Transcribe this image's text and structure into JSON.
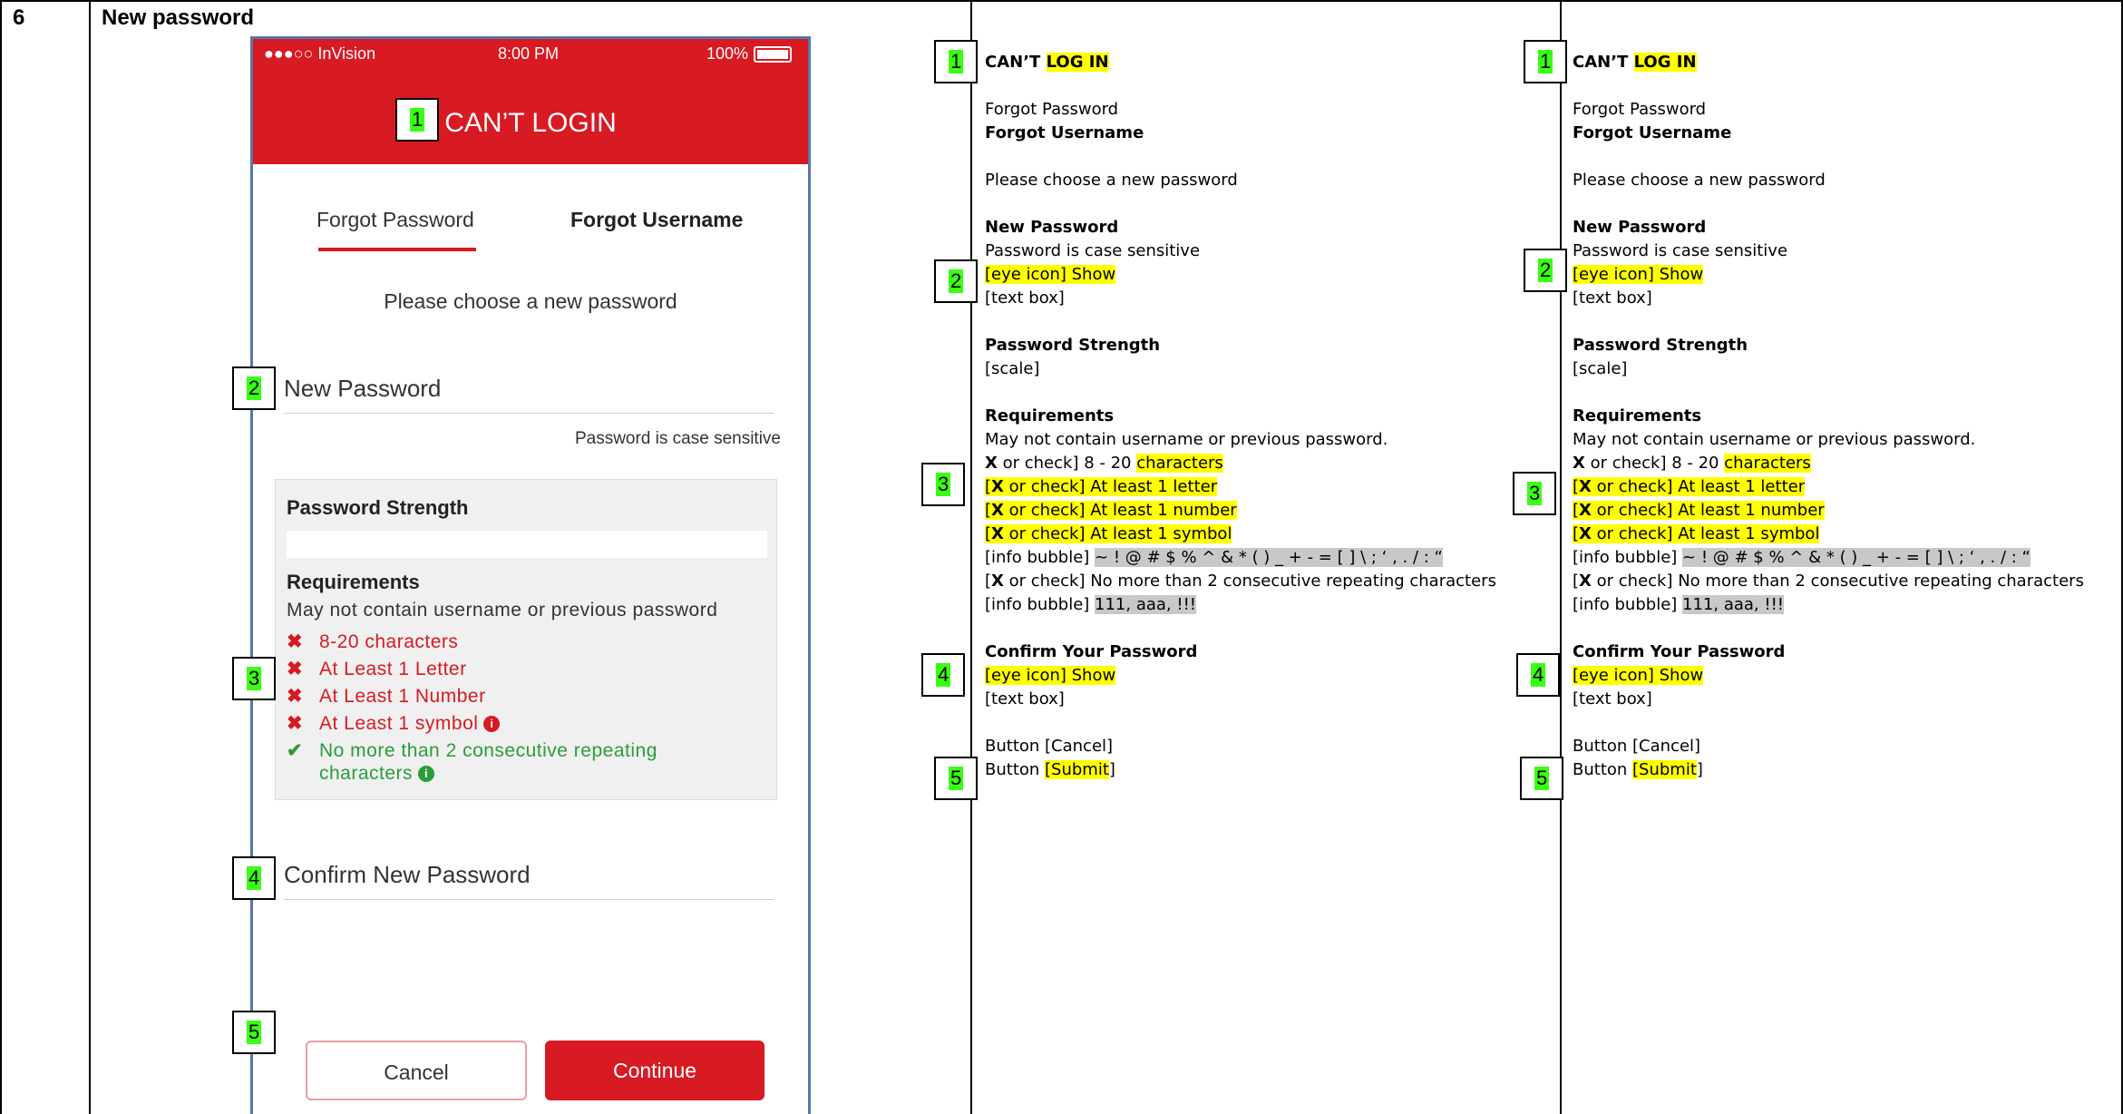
{
  "row": {
    "number": "6",
    "title": "New password"
  },
  "phone": {
    "status": {
      "carrier": "●●●○○ InVision",
      "time": "8:00 PM",
      "battery": "100%"
    },
    "header_title": "CAN’T LOGIN",
    "tabs": {
      "forgot_password": "Forgot Password",
      "forgot_username": "Forgot Username"
    },
    "instruction": "Please choose a new password",
    "new_password_label": "New Password",
    "case_note": "Password is case sensitive",
    "strength_title": "Password Strength",
    "requirements_title": "Requirements",
    "requirements_desc": "May not contain username or previous password",
    "requirements": [
      {
        "mark": "✖",
        "text": "8-20 characters",
        "status": "fail"
      },
      {
        "mark": "✖",
        "text": "At Least 1 Letter",
        "status": "fail"
      },
      {
        "mark": "✖",
        "text": "At Least 1 Number",
        "status": "fail"
      },
      {
        "mark": "✖",
        "text": "At Least 1 symbol",
        "status": "fail"
      },
      {
        "mark": "✔",
        "text": "No more than 2 consecutive repeating",
        "text2": "characters",
        "status": "pass"
      }
    ],
    "info_glyph": "i",
    "confirm_label": "Confirm New Password",
    "cancel": "Cancel",
    "continue": "Continue",
    "colors": {
      "brand_red": "#d81a22",
      "pass_green": "#2a9d3a"
    }
  },
  "markers": [
    "1",
    "2",
    "3",
    "4",
    "5"
  ],
  "spec": {
    "title_a": "CAN’T ",
    "title_b": "LOG IN",
    "forgot_password": "Forgot Password",
    "forgot_username": "Forgot Username",
    "choose": "Please choose a new password",
    "new_password": "New Password",
    "case": "Password is case sensitive",
    "eye_show": "[eye icon] Show",
    "text_box": "[text box]",
    "strength": "Password Strength",
    "scale": "[scale]",
    "requirements": "Requirements",
    "req_desc": "May not contain username or previous password.",
    "req1_a": "X",
    "req1_b": " or check] 8 - 20 ",
    "req1_c": "characters",
    "req_open": "[",
    "req_x": "X",
    "req_letter": " or check] At least 1 letter",
    "req_number": " or check] At least 1 number",
    "req_symbol": " or check] At least 1 symbol",
    "info_bubble": "[info bubble] ",
    "symbols": "  ~ ! @ # $ % ^ & * ( ) _ + - = [ ] \\ ; ‘ , . / : “",
    "req_repeat": " or check] No more than 2 consecutive repeating characters",
    "repeat_examples": "111, aaa, !!!",
    "confirm": "Confirm Your Password",
    "btn_cancel": "Button [Cancel]",
    "btn_submit_a": "Button ",
    "btn_submit_b": "[Submit",
    "btn_submit_c": "]"
  }
}
